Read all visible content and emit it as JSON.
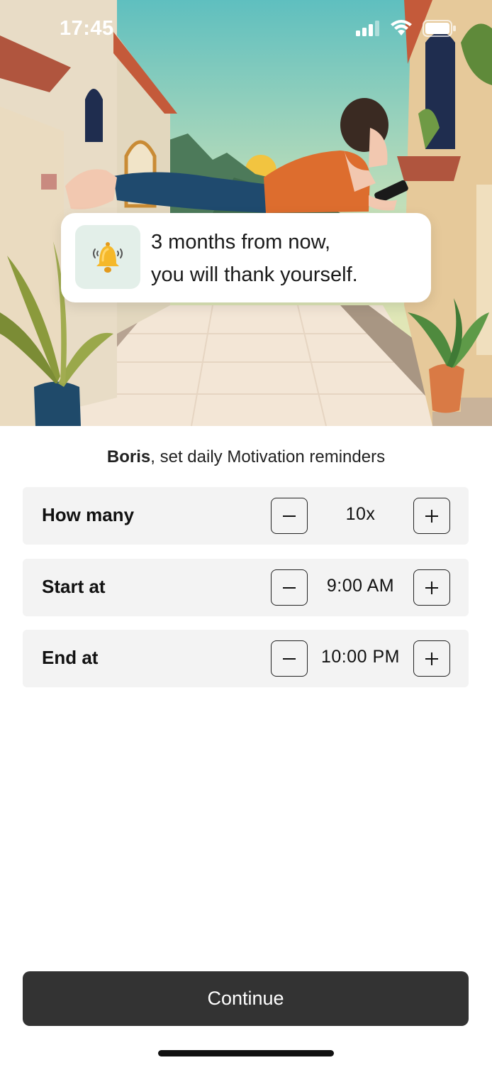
{
  "status_bar": {
    "time": "17:45"
  },
  "callout": {
    "icon": "bell-icon",
    "line1": "3 months from now,",
    "line2": "you will thank yourself."
  },
  "subtitle": {
    "name": "Boris",
    "text": ", set daily Motivation reminders"
  },
  "settings": [
    {
      "label": "How many",
      "value": "10x"
    },
    {
      "label": "Start at",
      "value": "9:00 AM"
    },
    {
      "label": "End at",
      "value": "10:00 PM"
    }
  ],
  "continue_label": "Continue",
  "colors": {
    "sky_top": "#5fbfbf",
    "sky_bottom": "#f2e8b0",
    "button_bg": "#333333",
    "row_bg": "#f3f3f3",
    "icon_box_bg": "#e3efe9"
  }
}
